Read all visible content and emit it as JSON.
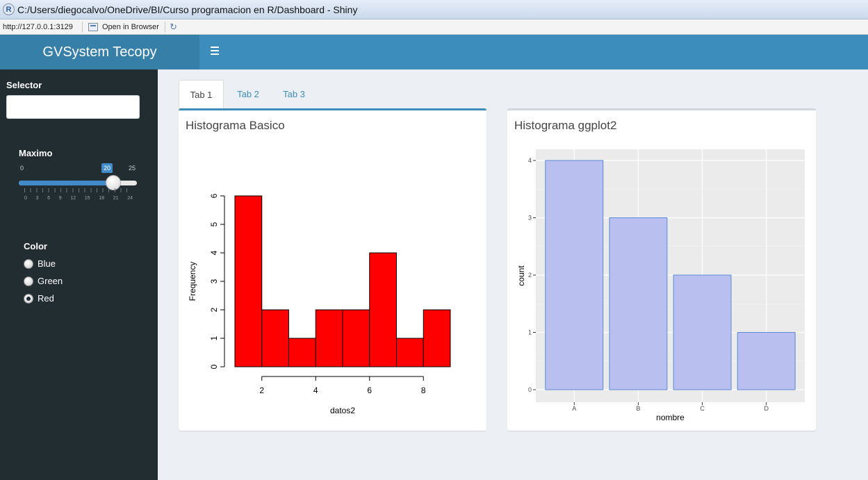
{
  "window": {
    "title": "C:/Users/diegocalvo/OneDrive/BI/Curso programacion en R/Dashboard - Shiny",
    "r_logo": "R"
  },
  "urlbar": {
    "url": "http://127.0.0.1:3129",
    "open_in_browser": "Open in Browser"
  },
  "header": {
    "brand": "GVSystem Tecopy"
  },
  "sidebar": {
    "selector_label": "Selector",
    "selector_value": "",
    "slider": {
      "label": "Maximo",
      "min": "0",
      "max": "25",
      "value": 20,
      "value_label": "20",
      "ticks": [
        "0",
        "3",
        "6",
        "9",
        "12",
        "15",
        "18",
        "21",
        "24"
      ]
    },
    "color_label": "Color",
    "color_options": [
      {
        "label": "Blue",
        "selected": false
      },
      {
        "label": "Green",
        "selected": false
      },
      {
        "label": "Red",
        "selected": true
      }
    ]
  },
  "tabs": [
    {
      "label": "Tab 1",
      "active": true
    },
    {
      "label": "Tab 2",
      "active": false
    },
    {
      "label": "Tab 3",
      "active": false
    }
  ],
  "boxes": {
    "basic_title": "Histograma Basico",
    "ggplot_title": "Histograma ggplot2"
  },
  "chart_data": [
    {
      "type": "bar",
      "subtype": "histogram",
      "title": "",
      "xlabel": "datos2",
      "ylabel": "Frequency",
      "bins": [
        [
          1,
          2
        ],
        [
          2,
          3
        ],
        [
          3,
          4
        ],
        [
          4,
          5
        ],
        [
          5,
          6
        ],
        [
          6,
          7
        ],
        [
          7,
          8
        ],
        [
          8,
          9
        ]
      ],
      "values": [
        6,
        2,
        1,
        2,
        2,
        4,
        1,
        2
      ],
      "xticks": [
        2,
        4,
        6,
        8
      ],
      "yticks": [
        0,
        1,
        2,
        3,
        4,
        5,
        6
      ],
      "xlim": [
        1,
        9
      ],
      "ylim": [
        0,
        6
      ],
      "fill_color": "#ff0000",
      "grid": false
    },
    {
      "type": "bar",
      "title": "",
      "xlabel": "nombre",
      "ylabel": "count",
      "categories": [
        "A",
        "B",
        "C",
        "D"
      ],
      "values": [
        4,
        3,
        2,
        1
      ],
      "yticks": [
        0,
        1,
        2,
        3,
        4
      ],
      "ylim": [
        0,
        4
      ],
      "fill_color": "#b9bfee",
      "border_color": "#5b8bd6",
      "panel_color": "#ebebeb",
      "grid": true
    }
  ]
}
